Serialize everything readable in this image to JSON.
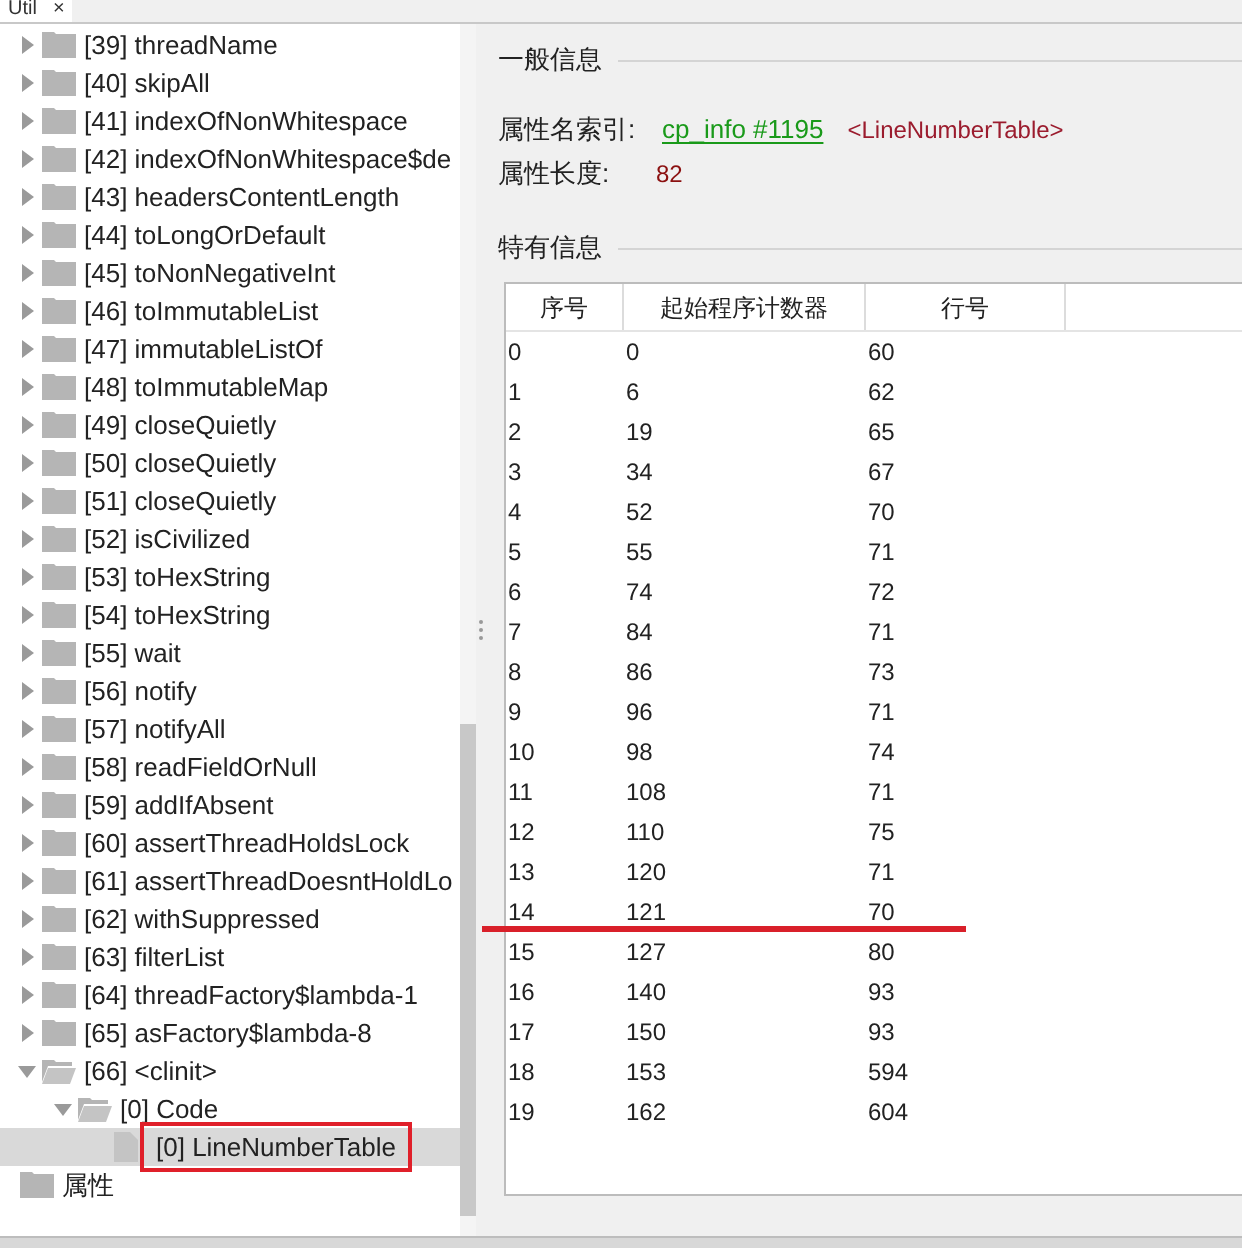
{
  "tab": {
    "title": "Util",
    "close": "×"
  },
  "tree": {
    "items": [
      {
        "label": "[39] threadName",
        "expanded": false,
        "selected": false
      },
      {
        "label": "[40] skipAll",
        "expanded": false,
        "selected": false
      },
      {
        "label": "[41] indexOfNonWhitespace",
        "expanded": false,
        "selected": false
      },
      {
        "label": "[42] indexOfNonWhitespace$de",
        "expanded": false,
        "selected": false
      },
      {
        "label": "[43] headersContentLength",
        "expanded": false,
        "selected": false
      },
      {
        "label": "[44] toLongOrDefault",
        "expanded": false,
        "selected": false
      },
      {
        "label": "[45] toNonNegativeInt",
        "expanded": false,
        "selected": false
      },
      {
        "label": "[46] toImmutableList",
        "expanded": false,
        "selected": false
      },
      {
        "label": "[47] immutableListOf",
        "expanded": false,
        "selected": false
      },
      {
        "label": "[48] toImmutableMap",
        "expanded": false,
        "selected": false
      },
      {
        "label": "[49] closeQuietly",
        "expanded": false,
        "selected": false
      },
      {
        "label": "[50] closeQuietly",
        "expanded": false,
        "selected": false
      },
      {
        "label": "[51] closeQuietly",
        "expanded": false,
        "selected": false
      },
      {
        "label": "[52] isCivilized",
        "expanded": false,
        "selected": false
      },
      {
        "label": "[53] toHexString",
        "expanded": false,
        "selected": false
      },
      {
        "label": "[54] toHexString",
        "expanded": false,
        "selected": false
      },
      {
        "label": "[55] wait",
        "expanded": false,
        "selected": false
      },
      {
        "label": "[56] notify",
        "expanded": false,
        "selected": false
      },
      {
        "label": "[57] notifyAll",
        "expanded": false,
        "selected": false
      },
      {
        "label": "[58] readFieldOrNull",
        "expanded": false,
        "selected": false
      },
      {
        "label": "[59] addIfAbsent",
        "expanded": false,
        "selected": false
      },
      {
        "label": "[60] assertThreadHoldsLock",
        "expanded": false,
        "selected": false
      },
      {
        "label": "[61] assertThreadDoesntHoldLo",
        "expanded": false,
        "selected": false
      },
      {
        "label": "[62] withSuppressed",
        "expanded": false,
        "selected": false
      },
      {
        "label": "[63] filterList",
        "expanded": false,
        "selected": false
      },
      {
        "label": "[64] threadFactory$lambda-1",
        "expanded": false,
        "selected": false
      },
      {
        "label": "[65] asFactory$lambda-8",
        "expanded": false,
        "selected": false
      },
      {
        "label": "[66] <clinit>",
        "expanded": true,
        "selected": false,
        "children": [
          {
            "label": "[0] Code",
            "expanded": true,
            "selected": false,
            "children": [
              {
                "label": "[0] LineNumberTable",
                "kind": "leaf",
                "selected": true,
                "highlighted": true
              }
            ]
          }
        ]
      }
    ],
    "outer_items": [
      {
        "label": "属性",
        "selected": false
      }
    ]
  },
  "general": {
    "title": "一般信息",
    "name_index_label": "属性名索引:",
    "name_index_link": "cp_info #1195",
    "name_index_value": "<LineNumberTable>",
    "length_label": "属性长度:",
    "length_value": "82"
  },
  "specific": {
    "title": "特有信息",
    "table": {
      "columns": [
        "序号",
        "起始程序计数器",
        "行号"
      ],
      "rows": [
        {
          "cells": [
            "0",
            "0",
            "60"
          ],
          "underlined": false
        },
        {
          "cells": [
            "1",
            "6",
            "62"
          ],
          "underlined": false
        },
        {
          "cells": [
            "2",
            "19",
            "65"
          ],
          "underlined": false
        },
        {
          "cells": [
            "3",
            "34",
            "67"
          ],
          "underlined": false
        },
        {
          "cells": [
            "4",
            "52",
            "70"
          ],
          "underlined": false
        },
        {
          "cells": [
            "5",
            "55",
            "71"
          ],
          "underlined": false
        },
        {
          "cells": [
            "6",
            "74",
            "72"
          ],
          "underlined": false
        },
        {
          "cells": [
            "7",
            "84",
            "71"
          ],
          "underlined": false
        },
        {
          "cells": [
            "8",
            "86",
            "73"
          ],
          "underlined": false
        },
        {
          "cells": [
            "9",
            "96",
            "71"
          ],
          "underlined": false
        },
        {
          "cells": [
            "10",
            "98",
            "74"
          ],
          "underlined": false
        },
        {
          "cells": [
            "11",
            "108",
            "71"
          ],
          "underlined": false
        },
        {
          "cells": [
            "12",
            "110",
            "75"
          ],
          "underlined": false
        },
        {
          "cells": [
            "13",
            "120",
            "71"
          ],
          "underlined": false
        },
        {
          "cells": [
            "14",
            "121",
            "70"
          ],
          "underlined": true
        },
        {
          "cells": [
            "15",
            "127",
            "80"
          ],
          "underlined": false
        },
        {
          "cells": [
            "16",
            "140",
            "93"
          ],
          "underlined": false
        },
        {
          "cells": [
            "17",
            "150",
            "93"
          ],
          "underlined": false
        },
        {
          "cells": [
            "18",
            "153",
            "594"
          ],
          "underlined": false
        },
        {
          "cells": [
            "19",
            "162",
            "604"
          ],
          "underlined": false
        }
      ]
    }
  }
}
